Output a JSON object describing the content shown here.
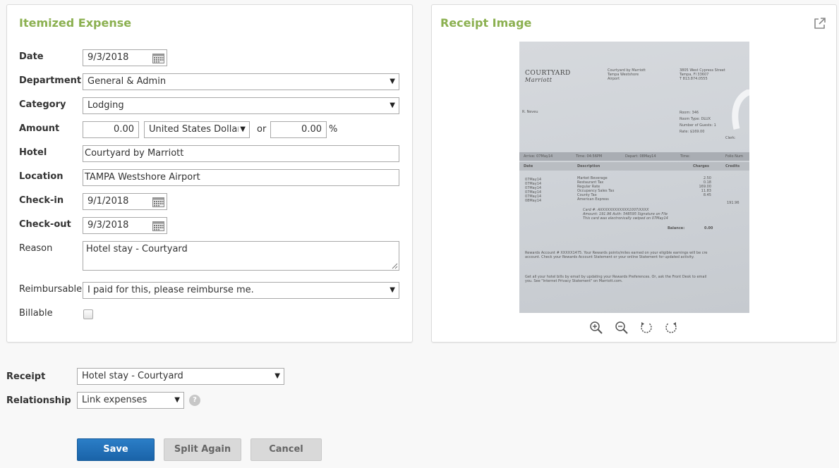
{
  "itemized": {
    "title": "Itemized Expense",
    "date_label": "Date",
    "date_value": "9/3/2018",
    "department_label": "Department",
    "department_value": "General & Admin",
    "category_label": "Category",
    "category_value": "Lodging",
    "amount_label": "Amount",
    "amount_value": "0.00",
    "currency_value": "United States Dollars",
    "or_text": "or",
    "percent_value": "0.00",
    "percent_sign": "%",
    "hotel_label": "Hotel",
    "hotel_value": "Courtyard by Marriott",
    "location_label": "Location",
    "location_value": "TAMPA Westshore Airport",
    "checkin_label": "Check-in",
    "checkin_value": "9/1/2018",
    "checkout_label": "Check-out",
    "checkout_value": "9/3/2018",
    "reason_label": "Reason",
    "reason_value": "Hotel stay - Courtyard",
    "reimbursable_label": "Reimbursable",
    "reimbursable_value": "I paid for this, please reimburse me.",
    "billable_label": "Billable",
    "billable_checked": false
  },
  "receipt_panel": {
    "title": "Receipt Image",
    "icons": [
      "external-link-icon",
      "zoom-in-icon",
      "zoom-out-icon",
      "rotate-left-icon",
      "rotate-right-icon"
    ],
    "receipt": {
      "logo_line1": "COURTYARD",
      "logo_line2": "Marriott",
      "header_mid": [
        "Courtyard by Marriott",
        "Tampa Westshore",
        "Airport"
      ],
      "header_right": [
        "3805 West Cypress Street",
        "Tampa, Fl 33607",
        "T 813.874.0555"
      ],
      "guest": "R. Neveu",
      "room_info": [
        "Room: 346",
        "Room Type: DLUX",
        "Number of Guests: 1",
        "Rate: $169.00"
      ],
      "clerk": "Clerk:",
      "band_items": [
        "Arrive: 07May14",
        "Time: 04:56PM",
        "Depart: 08May14",
        "Time:",
        "Folio Num"
      ],
      "col_headers": [
        "Date",
        "Description",
        "Charges",
        "Credits"
      ],
      "dates": [
        "07May14",
        "07May14",
        "07May14",
        "07May14",
        "07May14",
        "08May14"
      ],
      "descriptions": [
        "Market Beverage",
        "Restaurant Tax",
        "Regular Rate",
        "Occupancy Sales Tax",
        "County Tax",
        "American Express"
      ],
      "charges": [
        "2.50",
        "0.18",
        "169.00",
        "11.83",
        "8.45"
      ],
      "credit": "191.96",
      "card_lines": [
        "Card #: AXXXXXXXXXXXX1007/XXXX",
        "Amount: 191.96 Auth: 548595 Signature on File",
        "This card was electronically swiped on 07May14"
      ],
      "balance_label": "Balance:",
      "balance_value": "0.00",
      "rewards_lines": [
        "Rewards Account # XXXXX1475. Your Rewards points/miles earned on your eligible earnings will be cre",
        "account. Check your Rewards Account Statement or your online Statement for updated activity."
      ],
      "footer_lines": [
        "Get all your hotel bills by email by updating your Rewards Preferences. Or, ask the Front Desk to email",
        "you. See \"Internet Privacy Statement\" on Marriott.com."
      ]
    }
  },
  "bottom": {
    "receipt_label": "Receipt",
    "receipt_value": "Hotel stay - Courtyard",
    "relationship_label": "Relationship",
    "relationship_value": "Link expenses",
    "help_glyph": "?"
  },
  "buttons": {
    "save": "Save",
    "split_again": "Split Again",
    "cancel": "Cancel"
  },
  "colors": {
    "title_green": "#8bb050",
    "primary_blue": "#1f6fb8",
    "secondary_gray": "#d9d9d9"
  }
}
